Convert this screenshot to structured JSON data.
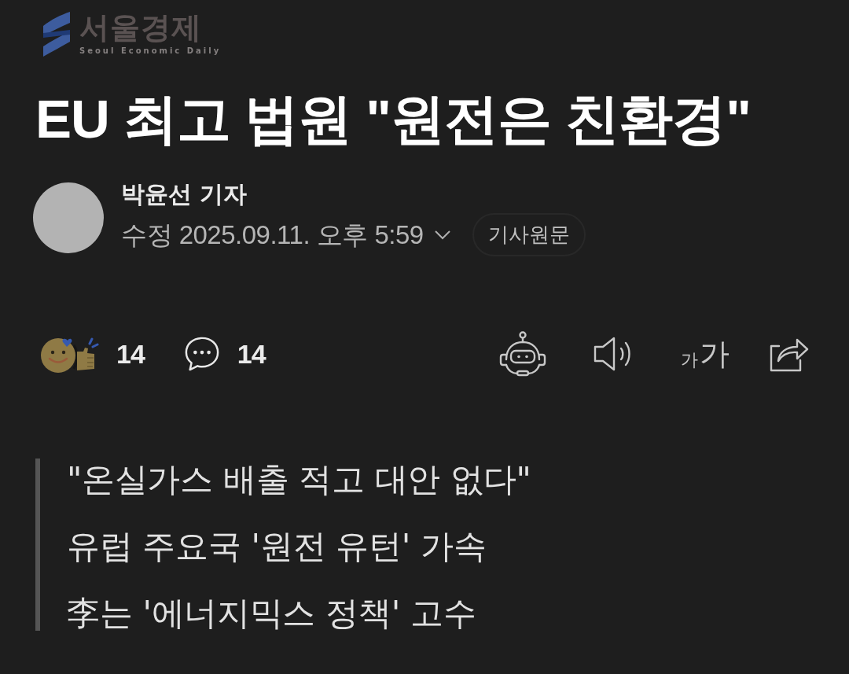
{
  "logo": {
    "wordmark": "서울경제",
    "tagline": "Seoul Economic Daily"
  },
  "headline": "EU 최고 법원 \"원전은 친환경\"",
  "byline": {
    "reporter": "박윤선 기자",
    "date": "수정 2025.09.11. 오후 5:59",
    "original_button": "기사원문"
  },
  "actions": {
    "reaction_count": "14",
    "comment_count": "14",
    "font_size": {
      "small": "가",
      "large": "가"
    }
  },
  "summary": [
    "\"온실가스 배출 적고 대안 없다\"",
    "유럽 주요국 '원전 유턴' 가속",
    "李는 '에너지믹스 정책' 고수"
  ]
}
